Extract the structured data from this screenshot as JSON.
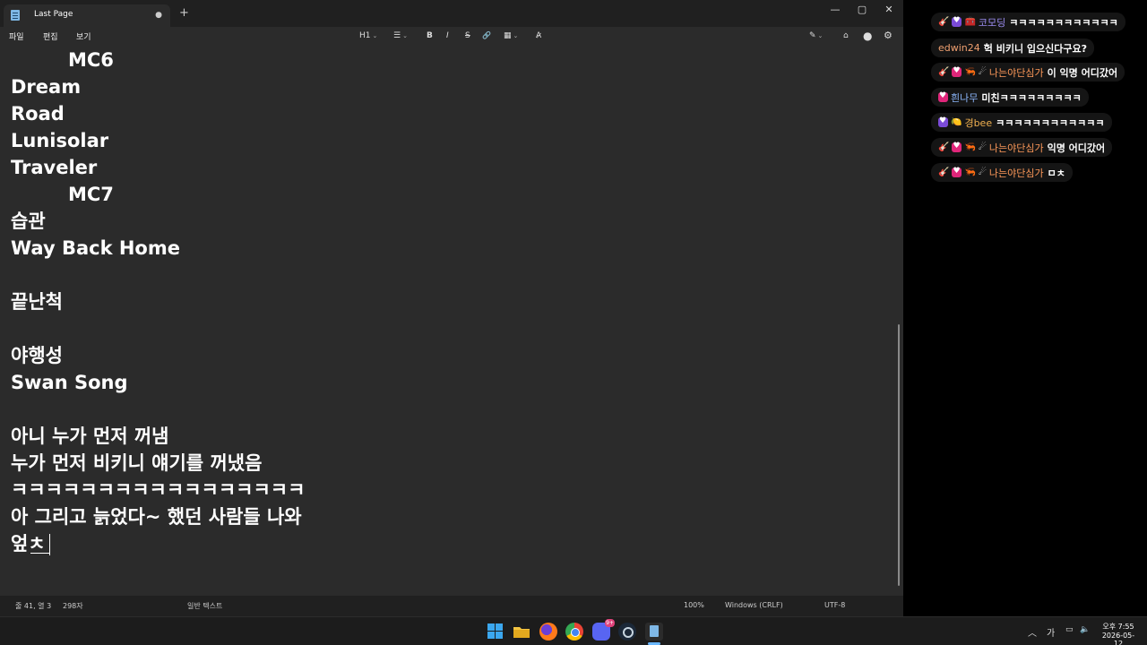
{
  "window": {
    "tab_title": "Last Page",
    "tab_modified": "●",
    "new_tab": "+",
    "minimize": "—",
    "maximize": "▢",
    "close": "✕"
  },
  "menu": {
    "file": "파일",
    "edit": "편집",
    "view": "보기"
  },
  "toolbar": {
    "heading": "H1",
    "list": "☰",
    "bold": "B",
    "italic": "I",
    "strike": "S",
    "link": "🔗",
    "table": "▦",
    "spell": "A̷",
    "copilot": "✎",
    "share": "⌂",
    "account": "●",
    "settings": "⚙"
  },
  "editor": {
    "lines": [
      "MC6",
      "Dream",
      "Road",
      "Lunisolar",
      "Traveler",
      "MC7",
      "습관",
      "Way Back Home",
      "",
      "끝난척",
      "",
      "야행성",
      "Swan Song",
      "",
      "아니 누가 먼저 꺼냄",
      "누가 먼저 비키니 얘기를 꺼냈음",
      "ㅋㅋㅋㅋㅋㅋㅋㅋㅋㅋㅋㅋㅋㅋㅋㅋㅋ",
      "아 그리고 늙었다~ 했던 사람들 나와",
      "엎ㅊ"
    ]
  },
  "status": {
    "position": "줄 41, 열 3",
    "chars": "298자",
    "format": "일반 텍스트",
    "zoom": "100%",
    "line_ending": "Windows (CRLF)",
    "encoding": "UTF-8"
  },
  "chat": {
    "messages": [
      {
        "nick": "코모딩",
        "nick_color": "#9b8cf0",
        "text": "ㅋㅋㅋㅋㅋㅋㅋㅋㅋㅋㅋㅋ"
      },
      {
        "nick": "edwin24",
        "nick_color": "#f0a070",
        "text": "헉 비키니 입으신다구요?"
      },
      {
        "nick": "나는야단심가",
        "nick_color": "#ff9a5a",
        "text": "이 익명 어디갔어"
      },
      {
        "nick": "흰나무",
        "nick_color": "#8ab4f8",
        "text": "미친ㅋㅋㅋㅋㅋㅋㅋㅋㅋ"
      },
      {
        "nick": "경bee",
        "nick_color": "#f0b050",
        "text": "ㅋㅋㅋㅋㅋㅋㅋㅋㅋㅋㅋㅋ"
      },
      {
        "nick": "나는야단심가",
        "nick_color": "#ff9a5a",
        "text": "익명 어디갔어"
      },
      {
        "nick": "나는야단심가",
        "nick_color": "#ff9a5a",
        "text": "ㅁㅊ"
      }
    ]
  },
  "taskbar": {
    "discord_badge": "9+",
    "tray_chevron": "︿",
    "ime": "가",
    "clock_time": "오후 7:55",
    "clock_date": "2026-05-12"
  }
}
